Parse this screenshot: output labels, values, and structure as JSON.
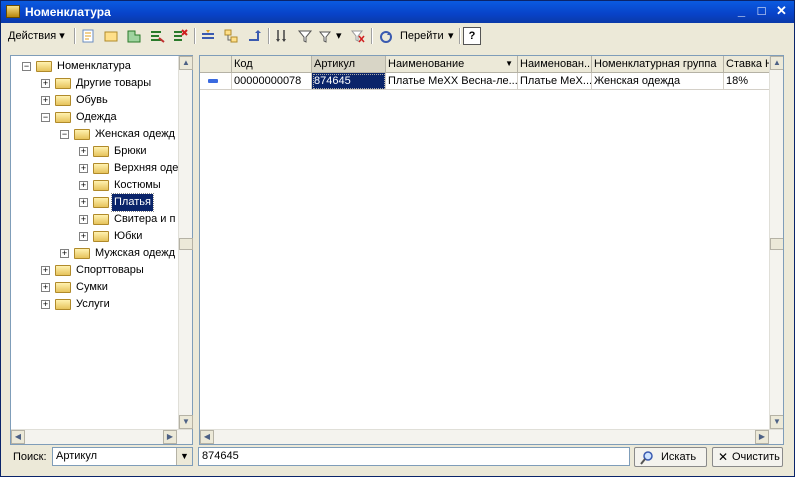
{
  "window": {
    "title": "Номенклатура",
    "minimize": "_",
    "maximize": "□",
    "close": "✕"
  },
  "toolbar": {
    "actions_label": "Действия",
    "goto_label": "Перейти",
    "help_label": "?"
  },
  "tree": {
    "root": "Номенклатура",
    "items": [
      {
        "label": "Другие товары"
      },
      {
        "label": "Обувь"
      },
      {
        "label": "Одежда"
      },
      {
        "label": "Женская одежд"
      },
      {
        "label": "Брюки"
      },
      {
        "label": "Верхняя оде"
      },
      {
        "label": "Костюмы"
      },
      {
        "label": "Платья"
      },
      {
        "label": "Свитера и п"
      },
      {
        "label": "Юбки"
      },
      {
        "label": "Мужская одежд"
      },
      {
        "label": "Спорттовары"
      },
      {
        "label": "Сумки"
      },
      {
        "label": "Услуги"
      }
    ]
  },
  "grid": {
    "headers": [
      "Код",
      "Артикул",
      "Наименование",
      "Наименован...",
      "Номенклатурная группа",
      "Ставка Н"
    ],
    "row": [
      "00000000078",
      "874645",
      "Платье МеХХ Весна-ле...",
      "Платье МеХ...",
      "Женская одежда",
      "18%"
    ]
  },
  "search": {
    "label": "Поиск:",
    "field": "Артикул",
    "value": "874645",
    "find_label": "Искать",
    "clear_label": "Очистить"
  }
}
